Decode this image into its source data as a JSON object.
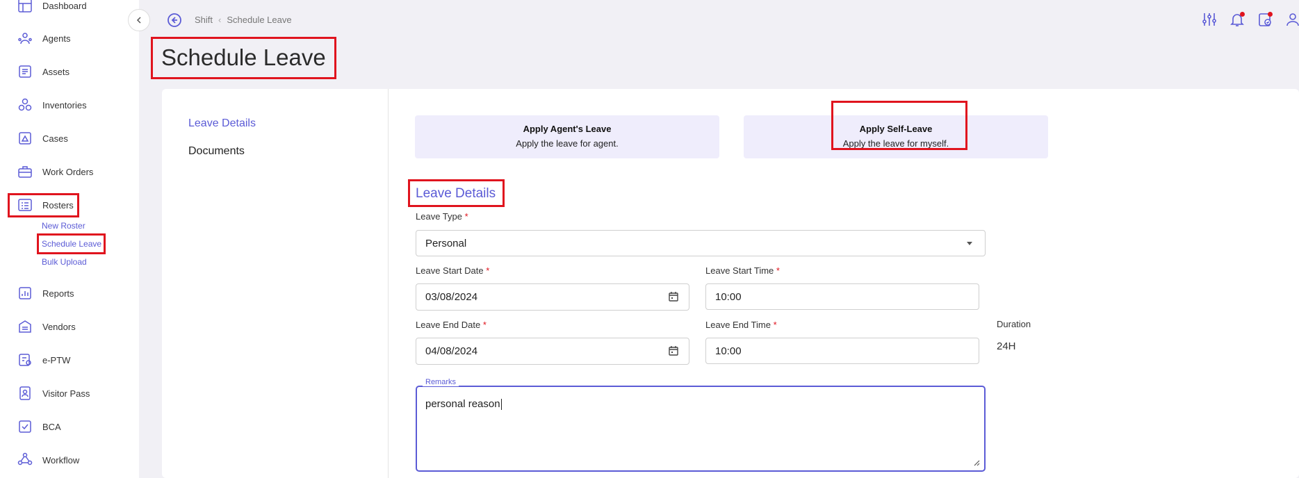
{
  "sidebar": {
    "items": [
      {
        "label": "Dashboard",
        "icon": "dashboard-icon"
      },
      {
        "label": "Agents",
        "icon": "agents-icon"
      },
      {
        "label": "Assets",
        "icon": "assets-icon"
      },
      {
        "label": "Inventories",
        "icon": "inventories-icon"
      },
      {
        "label": "Cases",
        "icon": "cases-icon"
      },
      {
        "label": "Work Orders",
        "icon": "work-orders-icon"
      },
      {
        "label": "Rosters",
        "icon": "rosters-icon"
      },
      {
        "label": "Reports",
        "icon": "reports-icon"
      },
      {
        "label": "Vendors",
        "icon": "vendors-icon"
      },
      {
        "label": "e-PTW",
        "icon": "eptw-icon"
      },
      {
        "label": "Visitor Pass",
        "icon": "visitor-pass-icon"
      },
      {
        "label": "BCA",
        "icon": "bca-icon"
      },
      {
        "label": "Workflow",
        "icon": "workflow-icon"
      }
    ],
    "rosters_sub": [
      "New Roster",
      "Schedule Leave",
      "Bulk Upload"
    ]
  },
  "breadcrumb": {
    "parent": "Shift",
    "current": "Schedule Leave"
  },
  "page_title": "Schedule Leave",
  "tabs": {
    "leave_details": "Leave Details",
    "documents": "Documents"
  },
  "apply_options": [
    {
      "title": "Apply Agent's Leave",
      "desc": "Apply the leave for agent."
    },
    {
      "title": "Apply Self-Leave",
      "desc": "Apply the leave for myself."
    }
  ],
  "form": {
    "section_title": "Leave Details",
    "leave_type": {
      "label": "Leave Type",
      "value": "Personal"
    },
    "start_date": {
      "label": "Leave Start Date",
      "value": "03/08/2024"
    },
    "start_time": {
      "label": "Leave Start Time",
      "value": "10:00"
    },
    "end_date": {
      "label": "Leave End Date",
      "value": "04/08/2024"
    },
    "end_time": {
      "label": "Leave End Time",
      "value": "10:00"
    },
    "duration": {
      "label": "Duration",
      "value": "24H"
    },
    "remarks": {
      "label": "Remarks",
      "value": "personal reason"
    },
    "required_mark": "*"
  },
  "colors": {
    "accent": "#5b5bd6",
    "highlight": "#e0141e",
    "card_bg": "#efedfc"
  }
}
